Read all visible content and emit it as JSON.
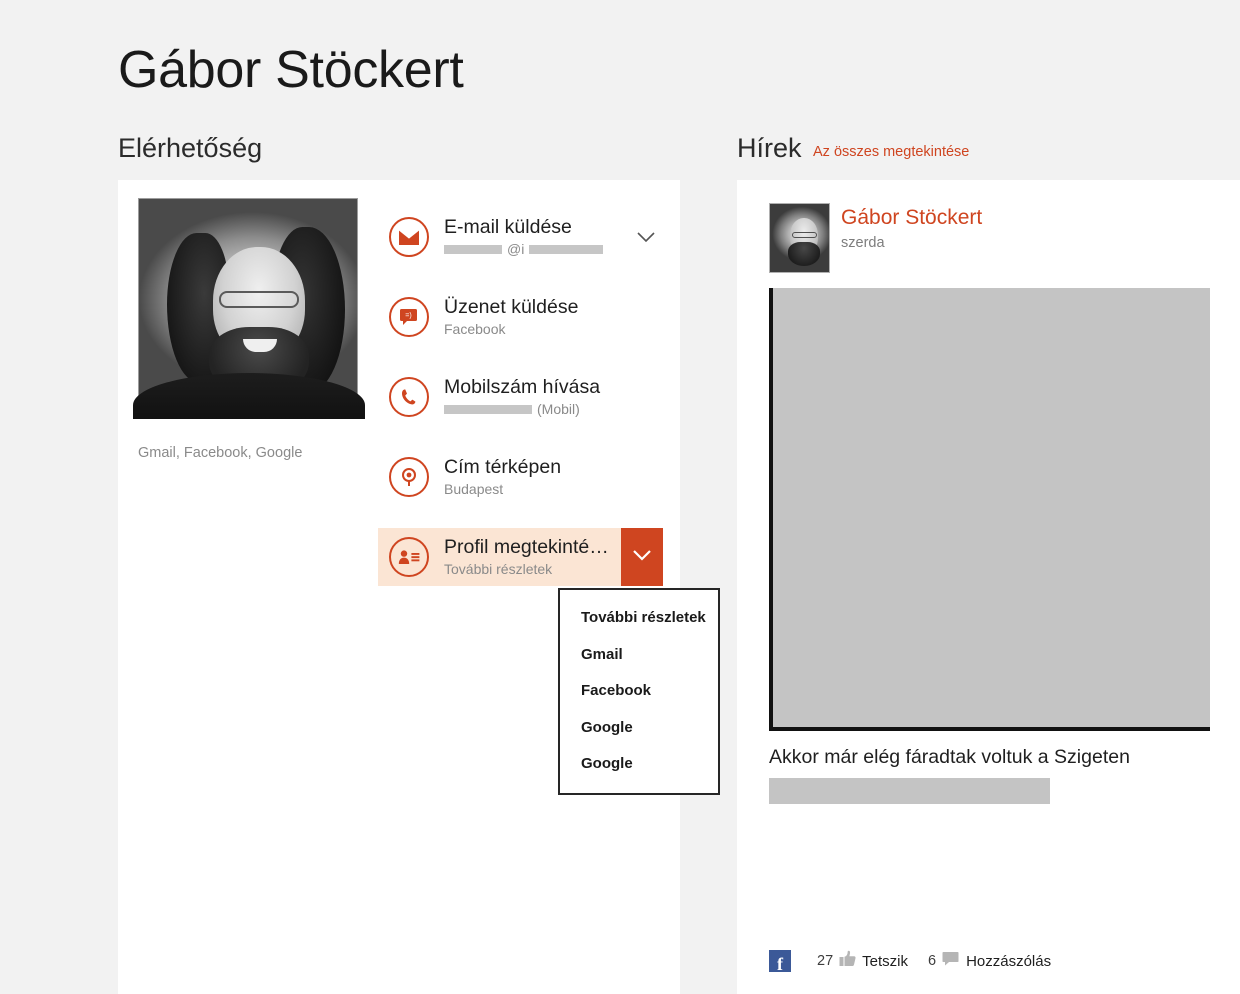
{
  "header": {
    "title": "Gábor Stöckert"
  },
  "contact": {
    "section_title": "Elérhetőség",
    "sources_label": "Gmail, Facebook, Google",
    "portrait_alt": "profile-photo",
    "actions": [
      {
        "title": "E-mail küldése",
        "sub_text": "@i",
        "sub_kind": "redacted-email",
        "icon": "mail-icon",
        "chevron": "chevron-down-icon",
        "selected": false
      },
      {
        "title": "Üzenet küldése",
        "sub_text": "Facebook",
        "sub_kind": "text",
        "icon": "message-icon",
        "chevron": null,
        "selected": false
      },
      {
        "title": "Mobilszám hívása",
        "sub_text": "(Mobil)",
        "sub_kind": "redacted-phone",
        "icon": "phone-icon",
        "chevron": null,
        "selected": false
      },
      {
        "title": "Cím térképen",
        "sub_text": "Budapest",
        "sub_kind": "text",
        "icon": "map-pin-icon",
        "chevron": null,
        "selected": false
      },
      {
        "title": "Profil megtekinté…",
        "sub_text": "További részletek",
        "sub_kind": "text",
        "icon": "profile-card-icon",
        "chevron": "chevron-down-icon",
        "selected": true
      }
    ],
    "dropdown": {
      "open": true,
      "items": [
        "További részletek",
        "Gmail",
        "Facebook",
        "Google",
        "Google"
      ]
    }
  },
  "news": {
    "section_title": "Hírek",
    "view_all_label": "Az összes megtekintése",
    "post": {
      "author": "Gábor Stöckert",
      "date": "szerda",
      "caption": "Akkor már elég fáradtak voltuk a Szigeten",
      "body_redacted": true,
      "image_placeholder": true,
      "footer": {
        "network_icon": "facebook-icon",
        "network_letter": "f",
        "likes_count": "27",
        "likes_label": "Tetszik",
        "comments_count": "6",
        "comments_label": "Hozzászólás",
        "like_icon": "thumbs-up-icon",
        "comment_icon": "comment-bubble-icon"
      }
    }
  },
  "theme": {
    "accent": "#cf4520",
    "accent_soft": "#fbe5d4",
    "page_bg": "#f2f2f2",
    "card_bg": "#ffffff",
    "redact_gray": "#c4c4c4",
    "facebook_blue": "#3b5998"
  }
}
